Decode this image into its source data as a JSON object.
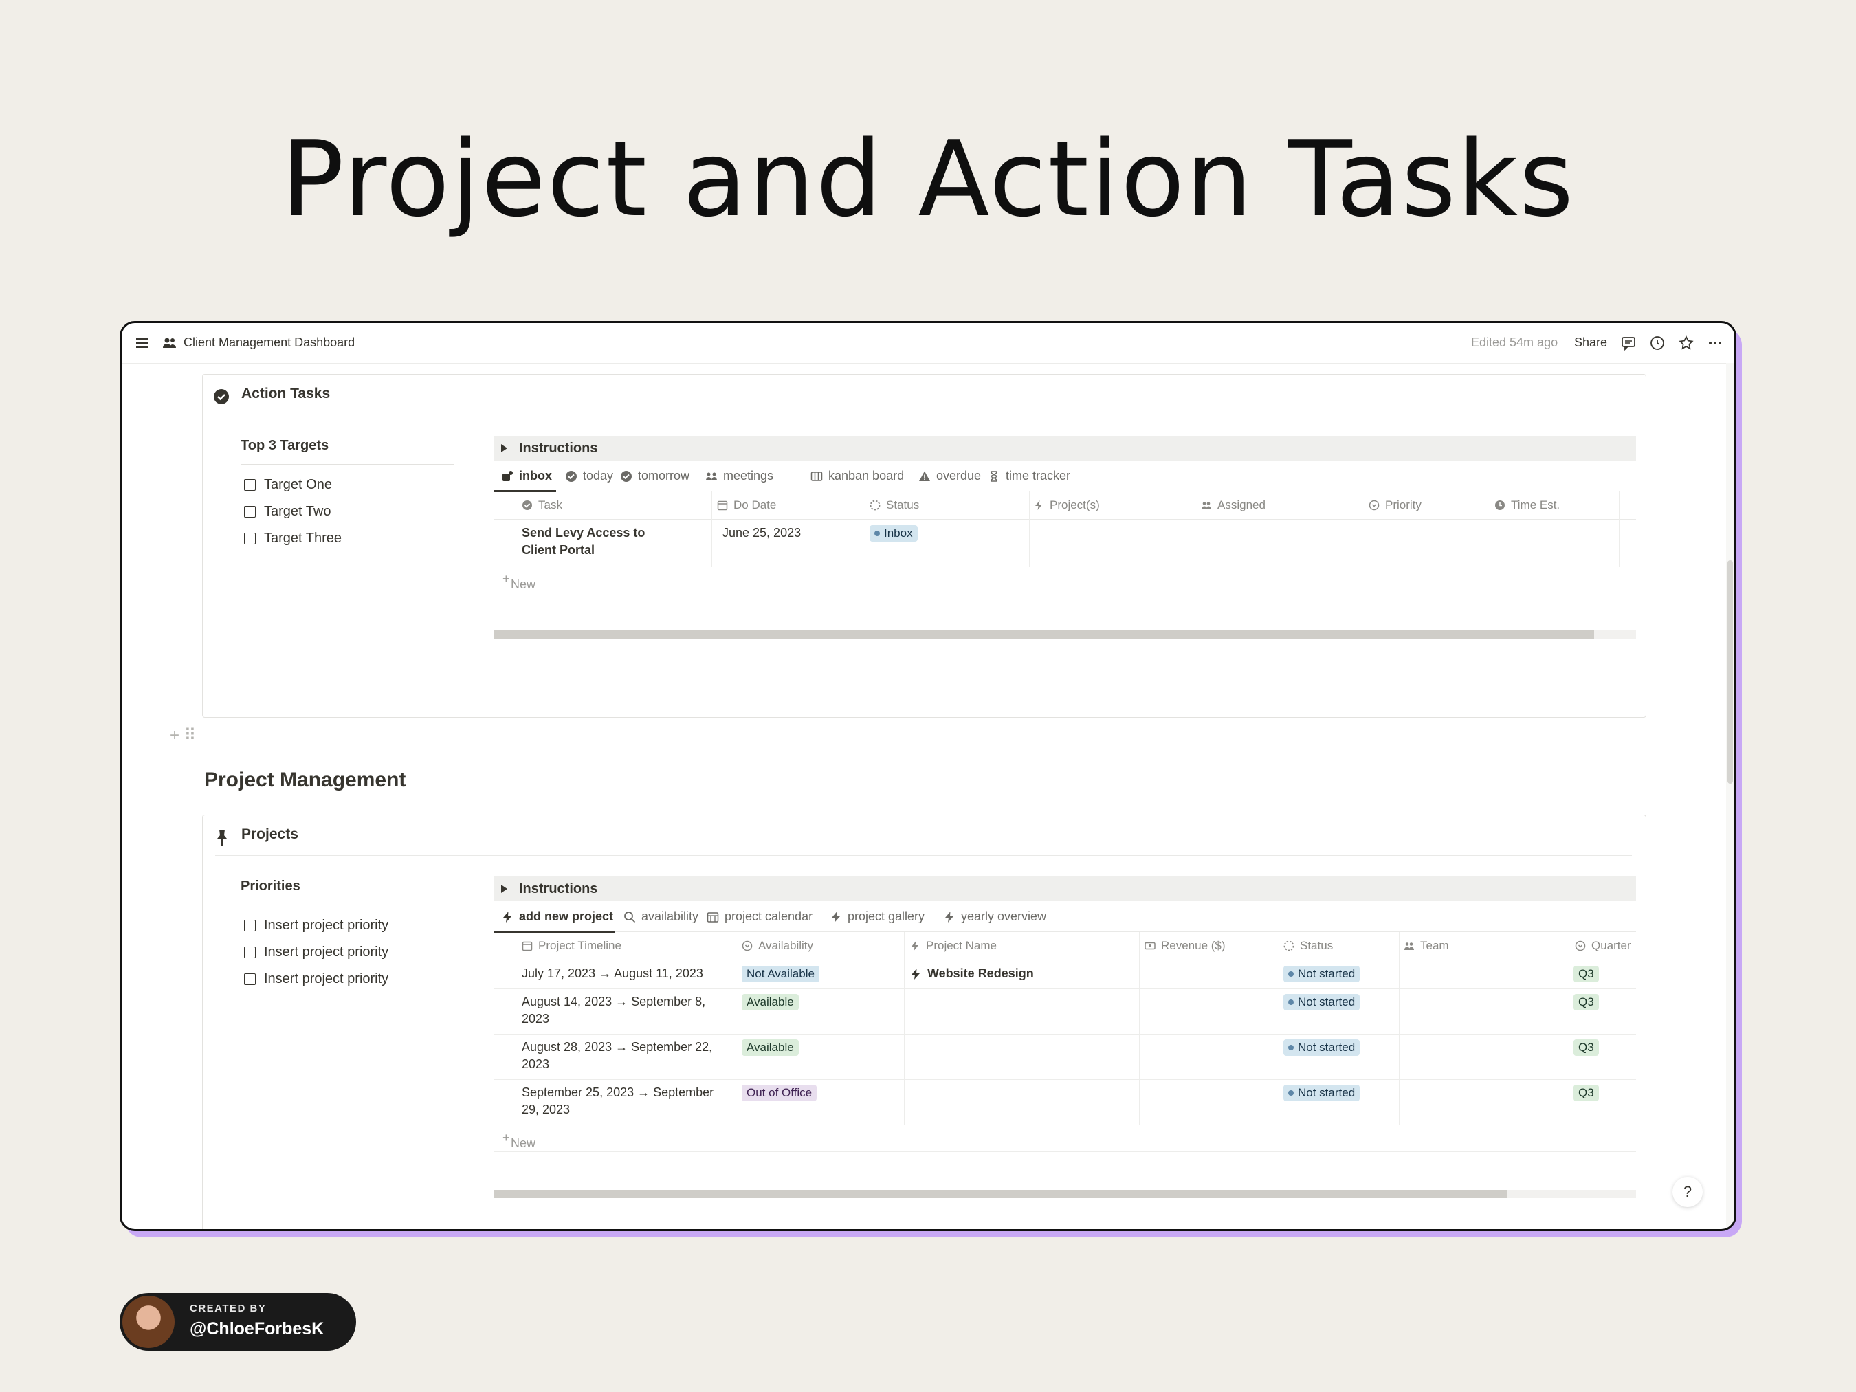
{
  "hero": {
    "title": "Project and Action Tasks"
  },
  "topbar": {
    "breadcrumb": "Client Management Dashboard",
    "edited": "Edited 54m ago",
    "share": "Share"
  },
  "action_tasks": {
    "heading": "Action Tasks",
    "targets_title": "Top 3 Targets",
    "targets": [
      "Target One",
      "Target Two",
      "Target Three"
    ],
    "instructions": "Instructions",
    "tabs": [
      "inbox",
      "today",
      "tomorrow",
      "meetings",
      "kanban board",
      "overdue",
      "time tracker"
    ],
    "columns": [
      "Task",
      "Do Date",
      "Status",
      "Project(s)",
      "Assigned",
      "Priority",
      "Time Est."
    ],
    "rows": [
      {
        "task": "Send Levy Access to Client Portal",
        "do_date": "June 25, 2023",
        "status": "Inbox"
      }
    ],
    "new_label": "New",
    "scroll_fraction": 0.963
  },
  "project_management": {
    "title": "Project Management",
    "heading": "Projects",
    "priorities_title": "Priorities",
    "priorities": [
      "Insert project priority",
      "Insert project priority",
      "Insert project priority"
    ],
    "instructions": "Instructions",
    "tabs": [
      "add new project",
      "availability",
      "project calendar",
      "project gallery",
      "yearly overview"
    ],
    "columns": [
      "Project Timeline",
      "Availability",
      "Project Name",
      "Revenue ($)",
      "Status",
      "Team",
      "Quarter"
    ],
    "rows": [
      {
        "timeline": "July 17, 2023 → August 11, 2023",
        "availability": "Not Available",
        "project": "Website Redesign",
        "status": "Not started",
        "quarter": "Q3"
      },
      {
        "timeline": "August 14, 2023 → September 8, 2023",
        "availability": "Available",
        "project": "",
        "status": "Not started",
        "quarter": "Q3"
      },
      {
        "timeline": "August 28, 2023 → September 22, 2023",
        "availability": "Available",
        "project": "",
        "status": "Not started",
        "quarter": "Q3"
      },
      {
        "timeline": "September 25, 2023 → September 29, 2023",
        "availability": "Out of Office",
        "project": "",
        "status": "Not started",
        "quarter": "Q3"
      }
    ],
    "new_label": "New",
    "scroll_fraction": 0.887
  },
  "help": "?",
  "credit": {
    "label": "CREATED BY",
    "handle": "@ChloeForbesK"
  },
  "colors": {
    "background": "#f1eee8",
    "accent_shadow": "#c8a8f5",
    "tag_blue": "#d3e5ef",
    "tag_red": "#ffe2dd",
    "tag_green": "#dbeddb",
    "tag_purple": "#e8deee"
  }
}
